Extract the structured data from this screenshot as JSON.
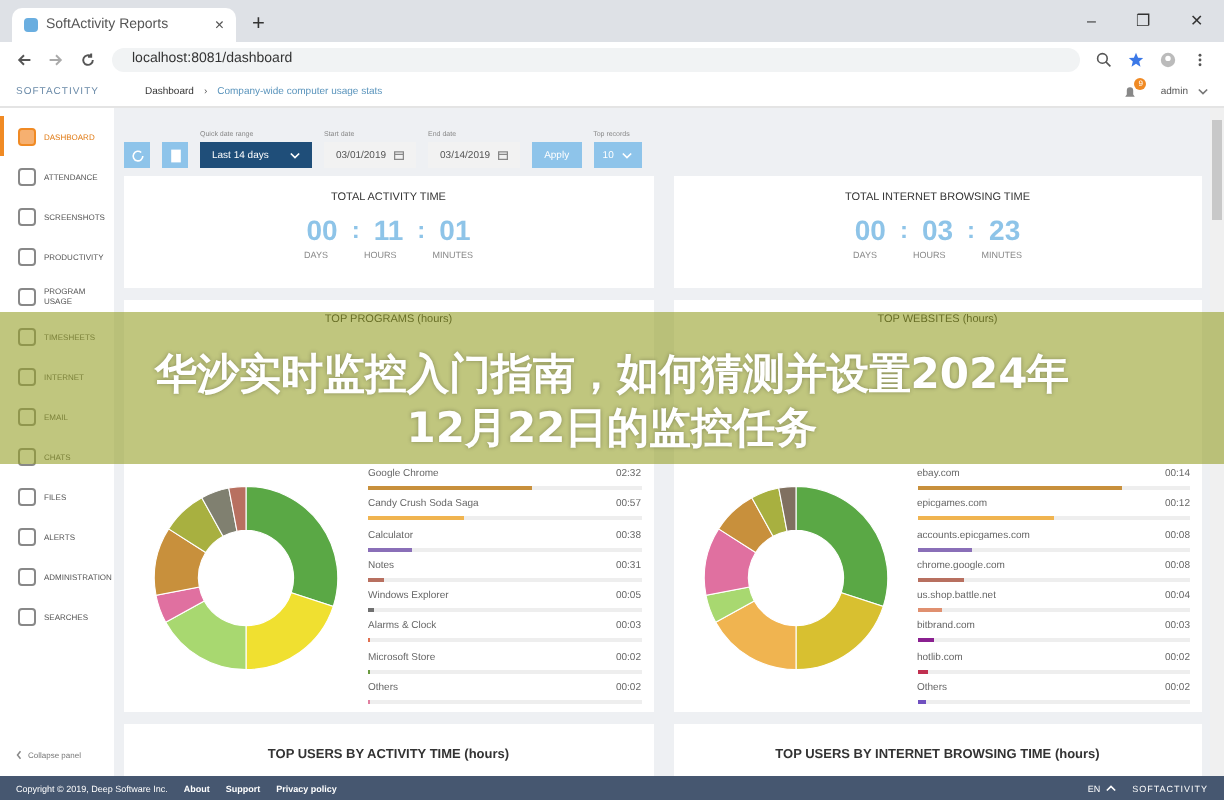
{
  "browser": {
    "tab_title": "SoftActivity Reports",
    "tab_close": "×",
    "new_tab": "+",
    "url": "localhost:8081/dashboard",
    "window_controls": [
      "–",
      "❐",
      "✕"
    ]
  },
  "app_header": {
    "logo": "SOFTACTIVITY",
    "breadcrumb": "Dashboard",
    "separator": "›",
    "subtitle": "Company-wide computer usage stats",
    "notification_count": "9",
    "user": "admin"
  },
  "sidebar": {
    "items": [
      {
        "label": "DASHBOARD",
        "selected": true
      },
      {
        "label": "ATTENDANCE",
        "selected": false
      },
      {
        "label": "SCREENSHOTS",
        "selected": false
      },
      {
        "label": "PRODUCTIVITY",
        "selected": false
      },
      {
        "label": "PROGRAM USAGE",
        "selected": false
      },
      {
        "label": "TIMESHEETS",
        "selected": false
      },
      {
        "label": "INTERNET",
        "selected": false
      },
      {
        "label": "EMAIL",
        "selected": false
      },
      {
        "label": "CHATS",
        "selected": false
      },
      {
        "label": "FILES",
        "selected": false
      },
      {
        "label": "ALERTS",
        "selected": false
      },
      {
        "label": "ADMINISTRATION",
        "selected": false
      },
      {
        "label": "SEARCHES",
        "selected": false
      }
    ],
    "collapse": "Collapse panel"
  },
  "toolbar": {
    "period_label": "Quick date range",
    "period": "Last 14 days",
    "start_label": "Start date",
    "start": "03/01/2019",
    "end_label": "End date",
    "end": "03/14/2019",
    "apply": "Apply",
    "users_label": "Top records",
    "users": "10"
  },
  "activity": {
    "title": "TOTAL ACTIVITY TIME",
    "days": "00",
    "hours": "11",
    "minutes": "01",
    "separator": ":",
    "units": [
      "DAYS",
      "HOURS",
      "MINUTES"
    ]
  },
  "browsing": {
    "title": "TOTAL INTERNET BROWSING TIME",
    "days": "00",
    "hours": "03",
    "minutes": "23",
    "separator": ":",
    "units": [
      "DAYS",
      "HOURS",
      "MINUTES"
    ]
  },
  "top_programs": {
    "title": "TOP PROGRAMS (hours)",
    "rows": [
      {
        "name": "Google Chrome",
        "value": "02:32",
        "level": 0.6,
        "color": "#c8903c"
      },
      {
        "name": "Candy Crush Soda Saga",
        "value": "00:57",
        "level": 0.35,
        "color": "#f0b450"
      },
      {
        "name": "Calculator",
        "value": "00:38",
        "level": 0.16,
        "color": "#8a6fb8"
      },
      {
        "name": "Notes",
        "value": "00:31",
        "level": 0.06,
        "color": "#b87060"
      },
      {
        "name": "Windows Explorer",
        "value": "00:05",
        "level": 0.02,
        "color": "#707070"
      },
      {
        "name": "Alarms & Clock",
        "value": "00:03",
        "level": 0.01,
        "color": "#e07050"
      },
      {
        "name": "Microsoft Store",
        "value": "00:02",
        "level": 0.01,
        "color": "#6a9a40"
      },
      {
        "name": "Others",
        "value": "00:02",
        "level": 0.01,
        "color": "#e080a0"
      }
    ]
  },
  "top_websites": {
    "title": "TOP WEBSITES (hours)",
    "rows": [
      {
        "name": "ebay.com",
        "value": "00:14",
        "level": 0.75,
        "color": "#c8903c"
      },
      {
        "name": "epicgames.com",
        "value": "00:12",
        "level": 0.5,
        "color": "#f0b450"
      },
      {
        "name": "accounts.epicgames.com",
        "value": "00:08",
        "level": 0.2,
        "color": "#8a6fb8"
      },
      {
        "name": "chrome.google.com",
        "value": "00:08",
        "level": 0.17,
        "color": "#b87060"
      },
      {
        "name": "us.shop.battle.net",
        "value": "00:04",
        "level": 0.09,
        "color": "#e09070"
      },
      {
        "name": "bitbrand.com",
        "value": "00:03",
        "level": 0.06,
        "color": "#8a2090"
      },
      {
        "name": "hotlib.com",
        "value": "00:02",
        "level": 0.04,
        "color": "#c03050"
      },
      {
        "name": "Others",
        "value": "00:02",
        "level": 0.03,
        "color": "#7050c0"
      }
    ]
  },
  "top_users_activity": {
    "title": "TOP USERS BY ACTIVITY TIME (hours)"
  },
  "top_users_browsing": {
    "title": "TOP USERS BY INTERNET BROWSING TIME (hours)"
  },
  "footer": {
    "copyright": "Copyright © 2019, Deep Software Inc.",
    "links": [
      "About",
      "Support",
      "Privacy policy"
    ],
    "language": "EN",
    "brand": "SOFTACTIVITY"
  },
  "banner": {
    "lines": [
      "华沙实时监控入门指南，如何猜测并设置2024年",
      "12月22日的监控任务"
    ]
  }
}
